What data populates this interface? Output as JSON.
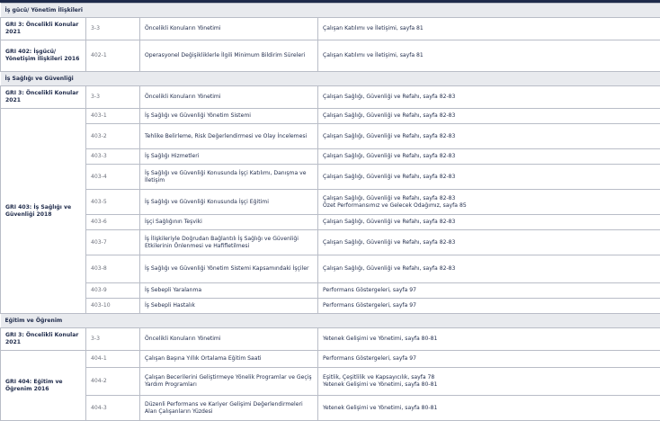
{
  "sections": {
    "s1": "İş gücü/ Yönetim İlişkileri",
    "s2": "İş Sağlığı ve Güvenliği",
    "s3": "Eğitim ve Öğrenim"
  },
  "rows": {
    "r1": {
      "std": "GRI 3: Öncelikli Konular 2021",
      "code": "3-3",
      "topic": "Öncelikli Konuların Yönetimi",
      "ref": "Çalışan Katılımı ve İletişimi, sayfa 81"
    },
    "r2": {
      "std": "GRI 402: İşgücü/ Yönetişim İlişkileri 2016",
      "code": "402-1",
      "topic": "Operasyonel Değişikliklerle İlgili Minimum Bildirim Süreleri",
      "ref": "Çalışan Katılımı ve İletişimi, sayfa 81"
    },
    "r3": {
      "std": "GRI 3: Öncelikli Konular 2021",
      "code": "3-3",
      "topic": "Öncelikli Konuların Yönetimi",
      "ref": "Çalışan Sağlığı, Güvenliği ve Refahı, sayfa 82-83"
    },
    "r4": {
      "std": "GRI 403: İş Sağlığı ve Güvenliği 2018",
      "code": "403-1",
      "topic": "İş Sağlığı ve Güvenliği Yönetim Sistemi",
      "ref": "Çalışan Sağlığı, Güvenliği ve Refahı, sayfa 82-83"
    },
    "r5": {
      "code": "403-2",
      "topic": "Tehlike Belirleme, Risk Değerlendirmesi ve Olay İncelemesi",
      "ref": "Çalışan Sağlığı, Güvenliği ve Refahı, sayfa 82-83"
    },
    "r6": {
      "code": "403-3",
      "topic": "İş Sağlığı Hizmetleri",
      "ref": "Çalışan Sağlığı, Güvenliği ve Refahı, sayfa 82-83"
    },
    "r7": {
      "code": "403-4",
      "topic": "İş Sağlığı ve Güvenliği Konusunda İşçi Katılımı, Danışma ve İletişim",
      "ref": "Çalışan Sağlığı, Güvenliği ve Refahı, sayfa 82-83"
    },
    "r8": {
      "code": "403-5",
      "topic": "İş Sağlığı ve Güvenliği Konusunda İşçi Eğitimi",
      "ref1": "Çalışan Sağlığı, Güvenliği ve Refahı, sayfa 82-83",
      "ref2": "Özet Performansımız ve Gelecek Odağımız, sayfa 85"
    },
    "r9": {
      "code": "403-6",
      "topic": "İşçi Sağlığının Teşviki",
      "ref": "Çalışan Sağlığı, Güvenliği ve Refahı, sayfa 82-83"
    },
    "r10": {
      "code": "403-7",
      "topic": "İş İlişkileriyle Doğrudan Bağlantılı İş Sağlığı ve Güvenliği Etkilerinin Önlenmesi ve Hafifletilmesi",
      "ref": "Çalışan Sağlığı, Güvenliği ve Refahı, sayfa 82-83"
    },
    "r11": {
      "code": "403-8",
      "topic": "İş Sağlığı ve Güvenliği Yönetim Sistemi Kapsamındaki İşçiler",
      "ref": "Çalışan Sağlığı, Güvenliği ve Refahı, sayfa 82-83"
    },
    "r12": {
      "code": "403-9",
      "topic": "İş Sebepli Yaralanma",
      "ref": "Performans Göstergeleri, sayfa 97"
    },
    "r13": {
      "code": "403-10",
      "topic": "İş Sebepli Hastalık",
      "ref": "Performans Göstergeleri, sayfa 97"
    },
    "r14": {
      "std": "GRI 3: Öncelikli Konular 2021",
      "code": "3-3",
      "topic": "Öncelikli Konuların Yönetimi",
      "ref": "Yetenek Gelişimi ve Yönetimi, sayfa 80-81"
    },
    "r15": {
      "std": "GRI 404: Eğitim ve Öğrenim 2016",
      "code": "404-1",
      "topic": "Çalışan Başına Yıllık Ortalama Eğitim Saati",
      "ref": "Performans Göstergeleri, sayfa 97"
    },
    "r16": {
      "code": "404-2",
      "topic": "Çalışan Becerilerini Geliştirmeye Yönelik Programlar ve Geçiş Yardım Programları",
      "ref1": "Eşitlik, Çeşitlilik ve Kapsayıcılık, sayfa 78",
      "ref2": "Yetenek Gelişimi ve Yönetimi, sayfa 80-81"
    },
    "r17": {
      "code": "404-3",
      "topic": "Düzenli Performans ve Kariyer Gelişimi Değerlendirmeleri Alan Çalışanların Yüzdesi",
      "ref": "Yetenek Gelişimi ve Yönetimi, sayfa 80-81"
    }
  }
}
